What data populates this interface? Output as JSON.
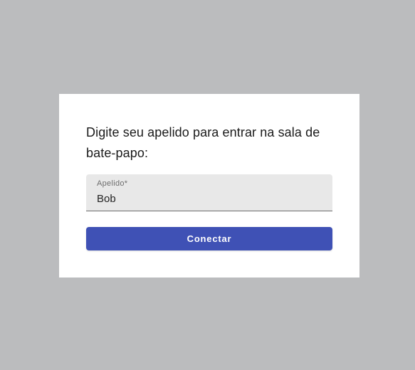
{
  "dialog": {
    "prompt": "Digite seu apelido para entrar na sala de bate-papo:",
    "nickname_field": {
      "label": "Apelido*",
      "value": "Bob"
    },
    "connect_label": "Conectar"
  },
  "colors": {
    "backdrop": "#bbbcbe",
    "dialog_background": "#ffffff",
    "field_background": "#e8e8e8",
    "button_accent": "#3f51b5"
  }
}
